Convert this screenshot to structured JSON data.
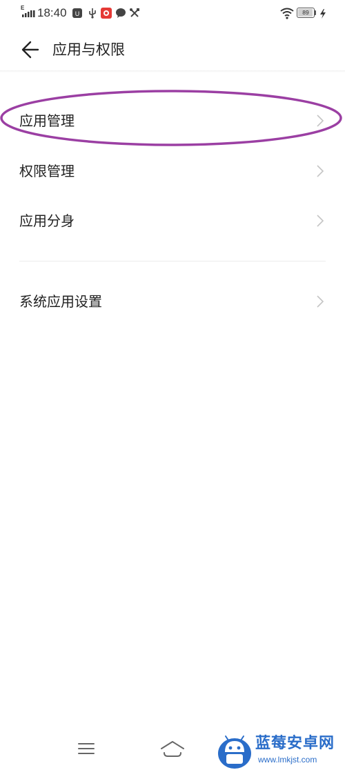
{
  "status_bar": {
    "network_type": "E",
    "time": "18:40",
    "battery_level": "89",
    "icons": [
      "signal-icon",
      "notification-app-icon",
      "usb-icon",
      "app-badge-icon",
      "chat-icon",
      "tools-icon",
      "wifi-icon",
      "battery-icon",
      "charging-icon"
    ]
  },
  "header": {
    "title": "应用与权限",
    "back_icon": "arrow-left-icon"
  },
  "menu": {
    "items": [
      {
        "label": "应用管理",
        "icon": "chevron-right-icon"
      },
      {
        "label": "权限管理",
        "icon": "chevron-right-icon"
      },
      {
        "label": "应用分身",
        "icon": "chevron-right-icon"
      },
      {
        "label": "系统应用设置",
        "icon": "chevron-right-icon"
      }
    ]
  },
  "annotation": {
    "color": "#9b3fa3"
  },
  "nav_bar": {
    "icons": [
      "menu-icon",
      "home-icon"
    ]
  },
  "watermark": {
    "name": "蓝莓安卓网",
    "url": "www.lmkjst.com",
    "color": "#2a6dc9"
  }
}
